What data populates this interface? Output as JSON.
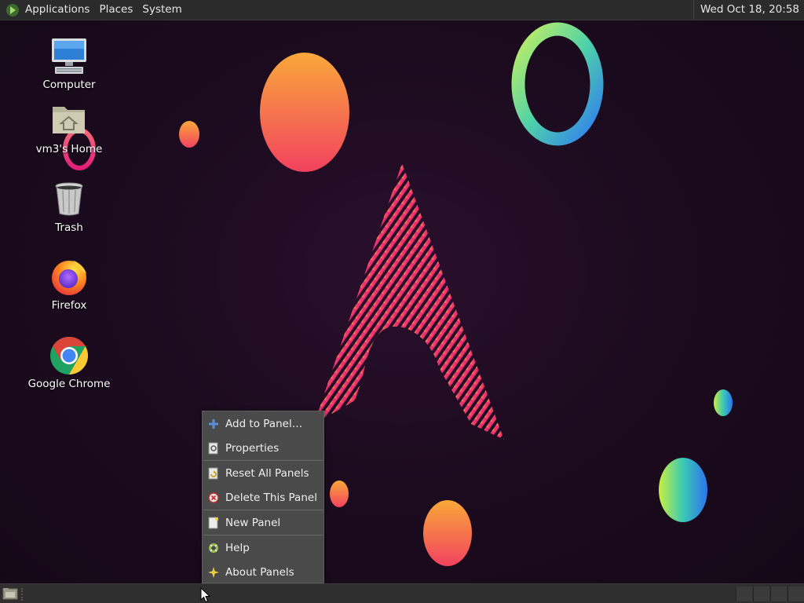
{
  "top_panel": {
    "menus": [
      "Applications",
      "Places",
      "System"
    ],
    "clock": "Wed Oct 18, 20:58"
  },
  "desktop_icons": [
    {
      "label": "Computer",
      "icon": "computer-icon"
    },
    {
      "label": "vm3's Home",
      "icon": "home-folder-icon"
    },
    {
      "label": "Trash",
      "icon": "trash-icon"
    },
    {
      "label": "Firefox",
      "icon": "firefox-icon"
    },
    {
      "label": "Google Chrome",
      "icon": "chrome-icon"
    }
  ],
  "context_menu": {
    "items": [
      {
        "label": "Add to Panel…",
        "icon": "add-icon"
      },
      {
        "label": "Properties",
        "icon": "properties-icon"
      },
      {
        "label": "Reset All Panels",
        "icon": "reset-icon"
      },
      {
        "label": "Delete This Panel",
        "icon": "delete-icon"
      },
      {
        "label": "New Panel",
        "icon": "new-panel-icon"
      },
      {
        "label": "Help",
        "icon": "help-icon"
      },
      {
        "label": "About Panels",
        "icon": "about-icon"
      }
    ]
  },
  "colors": {
    "panel_bg": "#2b2b2b",
    "menu_bg": "#4a4a4a",
    "wallpaper_bg": "#1c0b1f",
    "accent_pink": "#e8246f",
    "accent_orange": "#f5a623"
  }
}
